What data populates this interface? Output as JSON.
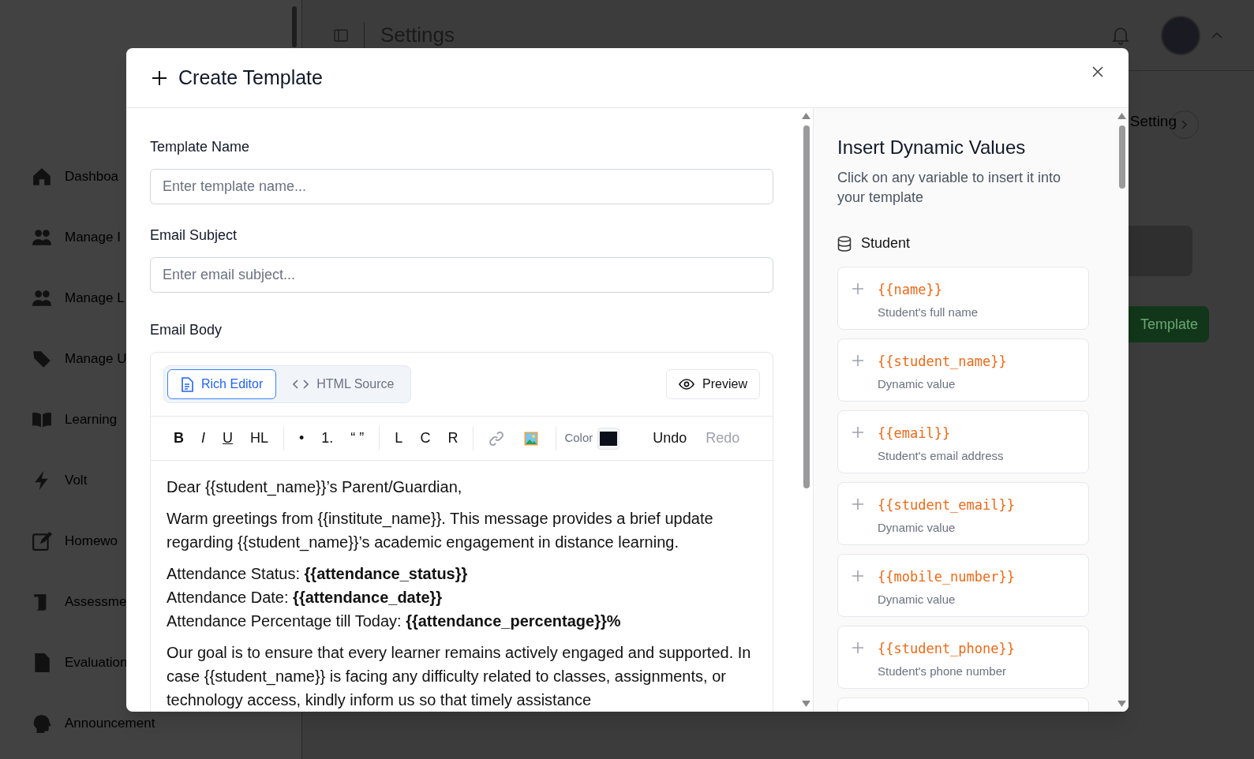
{
  "sidebar": {
    "items": [
      {
        "label": "Dashboa"
      },
      {
        "label": "Manage I"
      },
      {
        "label": "Manage L"
      },
      {
        "label": "Manage U"
      },
      {
        "label": "Learning"
      },
      {
        "label": "Volt"
      },
      {
        "label": "Homewo"
      },
      {
        "label": "Assessme"
      },
      {
        "label": "Evaluation"
      },
      {
        "label": "Announcement"
      }
    ]
  },
  "topbar": {
    "title": "Settings"
  },
  "background": {
    "tab": "Setting",
    "button": "Template"
  },
  "modal": {
    "title": "Create Template",
    "fields": [
      {
        "label": "Template Name",
        "placeholder": "Enter template name..."
      },
      {
        "label": "Email Subject",
        "placeholder": "Enter email subject..."
      }
    ],
    "body_label": "Email Body",
    "modes": [
      {
        "label": "Rich Editor",
        "selected": true
      },
      {
        "label": "HTML Source",
        "selected": false
      }
    ],
    "preview": "Preview",
    "toolbar": [
      {
        "kind": "bold",
        "label": "B"
      },
      {
        "kind": "italic",
        "label": "I"
      },
      {
        "kind": "underline",
        "label": "U"
      },
      {
        "kind": "text",
        "label": "HL"
      },
      {
        "kind": "sep"
      },
      {
        "kind": "text",
        "label": "•"
      },
      {
        "kind": "text",
        "label": "1."
      },
      {
        "kind": "text",
        "label": "“ ”"
      },
      {
        "kind": "sep"
      },
      {
        "kind": "text",
        "label": "L"
      },
      {
        "kind": "text",
        "label": "C"
      },
      {
        "kind": "text",
        "label": "R"
      },
      {
        "kind": "sep"
      },
      {
        "kind": "link"
      },
      {
        "kind": "image"
      },
      {
        "kind": "sep"
      },
      {
        "kind": "color",
        "label": "Color",
        "color": "#0b0f1a"
      },
      {
        "kind": "action",
        "label": "Undo",
        "disabled": false
      },
      {
        "kind": "action",
        "label": "Redo",
        "disabled": true
      }
    ],
    "body": [
      "Dear {{student_name}}’s Parent/Guardian,",
      "Warm greetings from {{institute_name}}. This message provides a brief update regarding {{student_name}}’s academic engagement in distance learning.",
      "Attendance Status: **{{attendance_status}}**\nAttendance Date: **{{attendance_date}}**\nAttendance Percentage till Today: **{{attendance_percentage}}%**",
      "Our goal is to ensure that every learner remains actively engaged and supported. In case {{student_name}} is facing any difficulty related to classes, assignments, or technology access, kindly inform us so that timely assistance"
    ],
    "panel": {
      "title": "Insert Dynamic Values",
      "subtitle": "Click on any variable to insert it into your template",
      "group": "Student",
      "variables": [
        {
          "name": "{{name}}",
          "description": "Student's full name"
        },
        {
          "name": "{{student_name}}",
          "description": "Dynamic value"
        },
        {
          "name": "{{email}}",
          "description": "Student's email address"
        },
        {
          "name": "{{student_email}}",
          "description": "Dynamic value"
        },
        {
          "name": "{{mobile_number}}",
          "description": "Dynamic value"
        },
        {
          "name": "{{student_phone}}",
          "description": "Student's phone number"
        }
      ]
    }
  }
}
